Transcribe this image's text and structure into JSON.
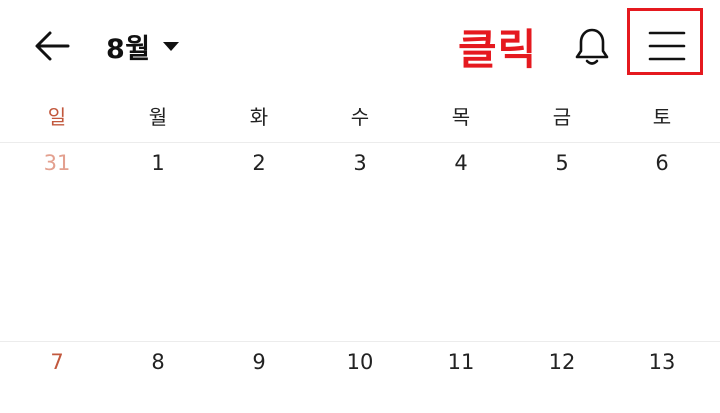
{
  "header": {
    "back_icon": "arrow-left-icon",
    "month_label": "8월",
    "dropdown_icon": "caret-down-icon",
    "bell_icon": "bell-icon",
    "menu_icon": "hamburger-menu-icon"
  },
  "annotation": {
    "text": "클릭",
    "color": "#e5191f"
  },
  "weekdays": [
    "일",
    "월",
    "화",
    "수",
    "목",
    "금",
    "토"
  ],
  "weeks": [
    [
      "31",
      "1",
      "2",
      "3",
      "4",
      "5",
      "6"
    ],
    [
      "7",
      "8",
      "9",
      "10",
      "11",
      "12",
      "13"
    ]
  ],
  "colors": {
    "sunday": "#c2583d",
    "prev_month_sunday": "#e3a08f",
    "highlight": "#e5191f"
  }
}
